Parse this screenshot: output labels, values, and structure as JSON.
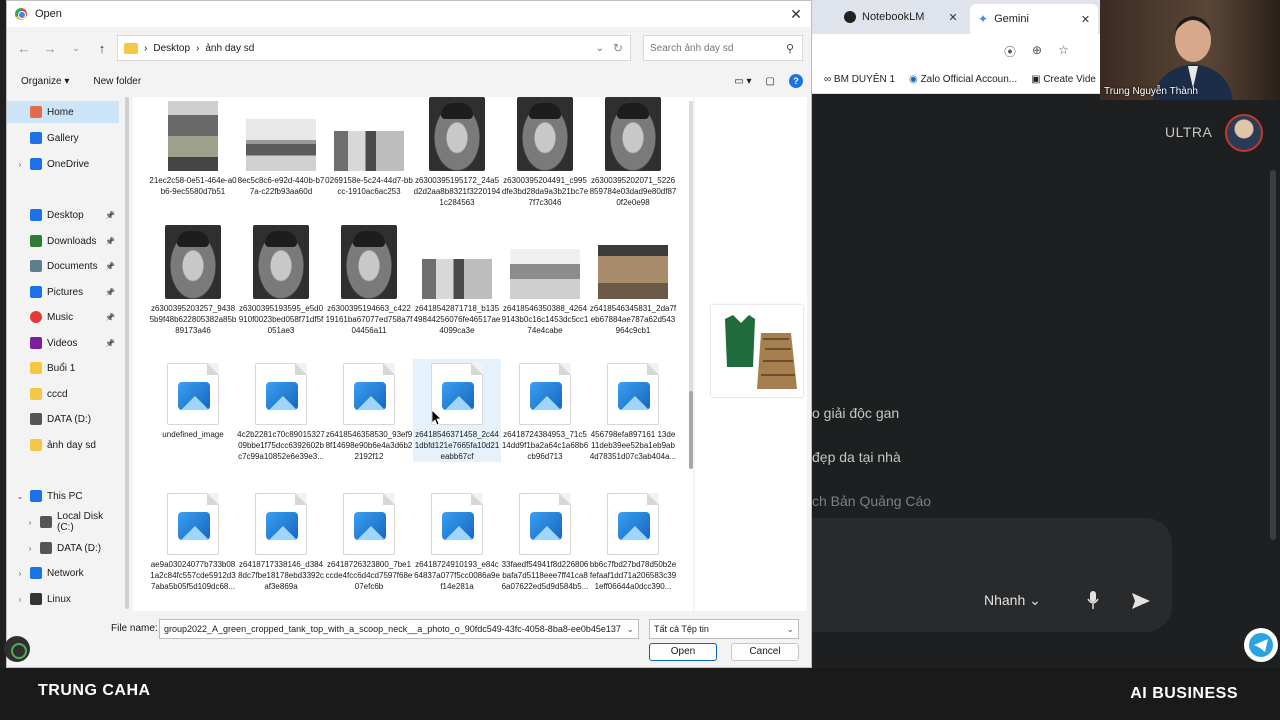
{
  "browser": {
    "tabs": [
      {
        "label": "NotebookLM"
      },
      {
        "label": "Gemini"
      }
    ],
    "bookmarks": [
      "BM DUYÊN 1",
      "Zalo Official Accoun...",
      "Create Vide"
    ],
    "ultra_label": "ULTRA",
    "suggestions": [
      "o giải độc gan",
      "đẹp da tại nhà",
      "ch Bản Quảng Cáo"
    ],
    "model_label": "Nhanh"
  },
  "webcam": {
    "name": "Trung Nguyễn Thành"
  },
  "dialog": {
    "title": "Open",
    "breadcrumb": [
      "Desktop",
      "ảnh day sd"
    ],
    "search_placeholder": "Search ảnh day sd",
    "organize_label": "Organize",
    "new_folder_label": "New folder",
    "sidebar": [
      {
        "label": "Home",
        "icon": "home-icon",
        "selected": true
      },
      {
        "label": "Gallery",
        "icon": "gallery-icon"
      },
      {
        "label": "OneDrive",
        "icon": "cloud-icon",
        "expander": true
      },
      {
        "label": "Desktop",
        "icon": "desktop-icon",
        "pinned": true
      },
      {
        "label": "Downloads",
        "icon": "download-icon",
        "pinned": true
      },
      {
        "label": "Documents",
        "icon": "documents-icon",
        "pinned": true
      },
      {
        "label": "Pictures",
        "icon": "pictures-icon",
        "pinned": true
      },
      {
        "label": "Music",
        "icon": "music-icon",
        "pinned": true
      },
      {
        "label": "Videos",
        "icon": "videos-icon",
        "pinned": true
      },
      {
        "label": "Buổi 1",
        "icon": "folder-icon"
      },
      {
        "label": "cccd",
        "icon": "folder-icon"
      },
      {
        "label": "DATA (D:)",
        "icon": "drive-icon"
      },
      {
        "label": "ảnh day sd",
        "icon": "folder-icon"
      },
      {
        "label": "This PC",
        "icon": "pc-icon",
        "expander": true
      },
      {
        "label": "Local Disk (C:)",
        "icon": "drive-icon",
        "expander": true
      },
      {
        "label": "DATA (D:)",
        "icon": "drive-icon",
        "expander": true
      },
      {
        "label": "Network",
        "icon": "network-icon",
        "expander": true
      },
      {
        "label": "Linux",
        "icon": "linux-icon",
        "expander": true
      }
    ],
    "files": [
      {
        "name": "21ec2c58-0e51-464e-a0b6-9ec5580d7b51",
        "thumb": "roomA"
      },
      {
        "name": "8ec5c8c6-e92d-440b-b77a-c22fb93aa60d",
        "thumb": "room"
      },
      {
        "name": "0269158e-5c24-44d7-bbcc-1910ac6ac253",
        "thumb": "room2"
      },
      {
        "name": "z6300395195172_24a5d2d2aa8b8321f32201941c284563",
        "thumb": "portrait"
      },
      {
        "name": "z6300395204491_c995dfe3bd28da9a3b21bc7e7f7c3046",
        "thumb": "portrait"
      },
      {
        "name": "z6300395202071_5226859784e03dad9e80df870f2e0e98",
        "thumb": "portrait"
      },
      {
        "name": "z6300395203257_94385b9f48b622805382a85b89173a46",
        "thumb": "portrait"
      },
      {
        "name": "z6300395193595_e5d0910f0023bed058f71df5f051ae3",
        "thumb": "portrait"
      },
      {
        "name": "z6300395194663_c42219161ba67077ed758a7f04456a11",
        "thumb": "portrait"
      },
      {
        "name": "z6418542871718_b13549844256076fe46517ae4099ca3e",
        "thumb": "room2"
      },
      {
        "name": "z6418546350388_42649143b0c16c1453dc5cc174e4cabe",
        "thumb": "house"
      },
      {
        "name": "z6418546345831_2da7feb67884ae787a62d543964c9cb1",
        "thumb": "hall"
      },
      {
        "name": "undefined_image",
        "thumb": "icon"
      },
      {
        "name": "4c2b2281c70c8901532709bbe1f75dcc6392602bc7c99a10852e6e39e3...",
        "thumb": "icon"
      },
      {
        "name": "z6418546358530_93ef98f14698e90b6e4a3d6b22192f12",
        "thumb": "icon"
      },
      {
        "name": "z6418546371458_2c441dbfd121e7665fa10d21eabb67cf",
        "thumb": "icon",
        "selected": true
      },
      {
        "name": "z6418724384953_71c514dd9f1ba2a64c1a68b6cb96d713",
        "thumb": "icon"
      },
      {
        "name": "456798efa897161 13de11deb39ee52ba1eb9ab4d78351d07c3ab404a...",
        "thumb": "icon"
      },
      {
        "name": "ae9a03024077b733b081a2c84fc557cde5912d37aba5b05f5d109dc68...",
        "thumb": "icon"
      },
      {
        "name": "z6418717338146_d3848dc7fbe18178ebd3392caf3e869a",
        "thumb": "icon"
      },
      {
        "name": "z6418726323800_7be1ccde4fcc6d4cd7597f68e07efc6b",
        "thumb": "icon"
      },
      {
        "name": "z6418724910193_e84c64837a077f5cc0086a9ef14e281a",
        "thumb": "icon"
      },
      {
        "name": "33faedf54941f8d226806bafa7d5118eee7ff41ca86a07622ed5d9d584b5...",
        "thumb": "icon"
      },
      {
        "name": "bb6c7fbd27bd78d50b2efefaaf1dd71a206583c391eff06644a0dcc390...",
        "thumb": "icon"
      }
    ],
    "file_name_label": "File name:",
    "file_name_value": "group2022_A_green_cropped_tank_top_with_a_scoop_neck__a_photo_o_90fdc549-43fc-4058-8ba8-ee0b45e137",
    "file_type_value": "Tất cả Tệp tin",
    "open_label": "Open",
    "cancel_label": "Cancel"
  },
  "banner": {
    "left": "TRUNG CAHA",
    "right": "AI BUSINESS"
  }
}
